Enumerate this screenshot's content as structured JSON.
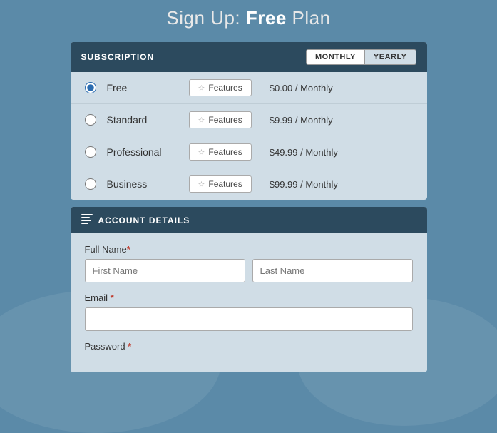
{
  "page": {
    "title_prefix": "Sign Up: ",
    "title_highlight": "Free",
    "title_suffix": " Plan"
  },
  "subscription": {
    "header_label": "SUBSCRIPTION",
    "billing_monthly": "MONTHLY",
    "billing_yearly": "YEARLY",
    "plans": [
      {
        "id": "free",
        "name": "Free",
        "price": "$0.00 / Monthly",
        "selected": true
      },
      {
        "id": "standard",
        "name": "Standard",
        "price": "$9.99 / Monthly",
        "selected": false
      },
      {
        "id": "professional",
        "name": "Professional",
        "price": "$49.99 / Monthly",
        "selected": false
      },
      {
        "id": "business",
        "name": "Business",
        "price": "$99.99 / Monthly",
        "selected": false
      }
    ],
    "features_btn_label": "Features"
  },
  "account": {
    "header_label": "ACCOUNT DETAILS",
    "full_name_label": "Full Name",
    "first_name_placeholder": "First Name",
    "last_name_placeholder": "Last Name",
    "email_label": "Email",
    "email_placeholder": "",
    "password_label": "Password"
  }
}
